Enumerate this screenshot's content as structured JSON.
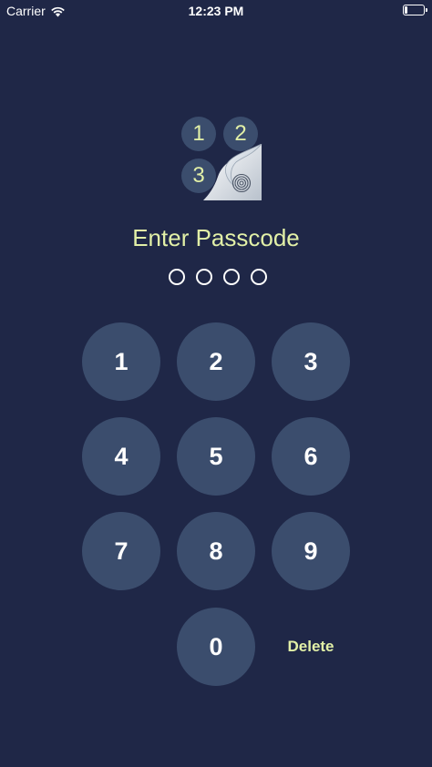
{
  "status_bar": {
    "carrier": "Carrier",
    "time": "12:23 PM"
  },
  "logo": {
    "digits": [
      "1",
      "2",
      "3"
    ]
  },
  "title": "Enter Passcode",
  "passcode": {
    "length": 4,
    "filled": 0
  },
  "keypad": {
    "keys": [
      "1",
      "2",
      "3",
      "4",
      "5",
      "6",
      "7",
      "8",
      "9",
      "0"
    ],
    "delete_label": "Delete"
  },
  "colors": {
    "background": "#1f2747",
    "key_fill": "#3b4d6d",
    "accent": "#e2f0a7"
  }
}
